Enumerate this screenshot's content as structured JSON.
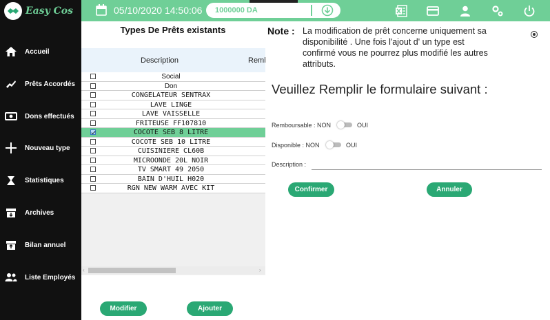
{
  "app": {
    "logo_text": "Easy Cos",
    "datetime": "05/10/2020 14:50:06",
    "amount": "1000000 DA",
    "colors": {
      "accent": "#6fcf97",
      "button": "#2aa874",
      "sidebar": "#111111"
    }
  },
  "top_icons": [
    "excel-icon",
    "card-icon",
    "user-icon",
    "settings-icon",
    "power-icon"
  ],
  "sidebar": {
    "items": [
      {
        "label": "Accueil",
        "icon": "home-icon"
      },
      {
        "label": "Prêts Accordés",
        "icon": "handshake-icon"
      },
      {
        "label": "Dons effectués",
        "icon": "money-icon"
      },
      {
        "label": "Nouveau type",
        "icon": "plus-icon"
      },
      {
        "label": "Statistiques",
        "icon": "chart-icon"
      },
      {
        "label": "Archives",
        "icon": "archive-icon"
      },
      {
        "label": "Bilan annuel",
        "icon": "archive-up-icon"
      },
      {
        "label": "Liste Employés",
        "icon": "people-icon"
      }
    ]
  },
  "panel": {
    "title": "Types De Prêts existants",
    "columns": [
      "Description",
      "Remb"
    ],
    "rows": [
      {
        "description": "Social",
        "checked": false,
        "selected": false,
        "prop": true
      },
      {
        "description": "Don",
        "checked": false,
        "selected": false,
        "prop": true
      },
      {
        "description": "CONGELATEUR SENTRAX",
        "checked": false,
        "selected": false,
        "prop": false
      },
      {
        "description": "LAVE LINGE",
        "checked": false,
        "selected": false,
        "prop": false
      },
      {
        "description": "LAVE VAISSELLE",
        "checked": false,
        "selected": false,
        "prop": false
      },
      {
        "description": "FRITEUSE FF107810",
        "checked": false,
        "selected": false,
        "prop": false
      },
      {
        "description": "COCOTE SEB 8 LITRE",
        "checked": true,
        "selected": true,
        "prop": false
      },
      {
        "description": "COCOTE SEB 10 LITRE",
        "checked": false,
        "selected": false,
        "prop": false
      },
      {
        "description": "CUISINIERE CL60B",
        "checked": false,
        "selected": false,
        "prop": false
      },
      {
        "description": "MICROONDE 20L NOIR",
        "checked": false,
        "selected": false,
        "prop": false
      },
      {
        "description": "TV SMART 49 2050",
        "checked": false,
        "selected": false,
        "prop": false
      },
      {
        "description": "BAIN D'HUIL H020",
        "checked": false,
        "selected": false,
        "prop": false
      },
      {
        "description": "RGN NEW WARM AVEC KIT",
        "checked": false,
        "selected": false,
        "prop": false
      }
    ],
    "modify_label": "Modifier",
    "add_label": "Ajouter"
  },
  "form": {
    "note_label": "Note :",
    "note_line1": "La modification de prêt concerne uniquement sa",
    "note_line2": "disponibilité . Une fois l'ajout d' un type est",
    "note_line3": " confirmé vous ne pourrez plus modifié les autres",
    "note_line4": "attributs.",
    "heading": "Veuillez Remplir le formulaire suivant :",
    "remboursable_label": "Remboursable : NON",
    "disponible_label": "Disponible : NON",
    "oui_label": "OUI",
    "description_label": "Description :",
    "confirm_label": "Confirmer",
    "cancel_label": "Annuler"
  }
}
